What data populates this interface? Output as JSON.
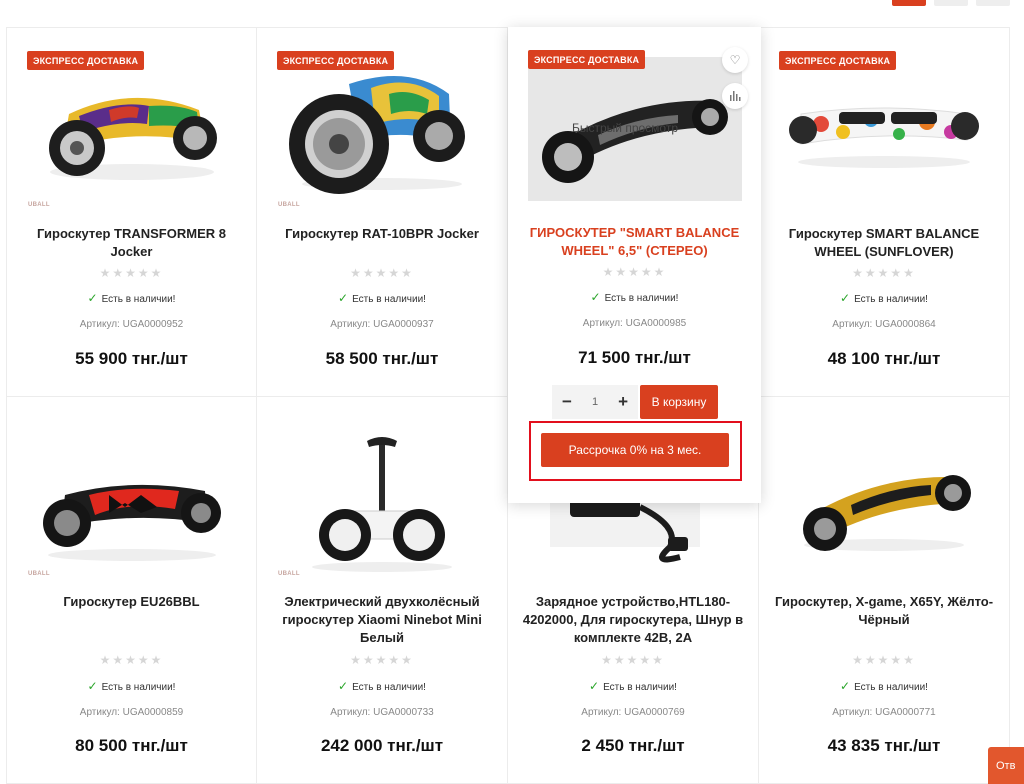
{
  "pagination": {
    "pages": 3,
    "active": 1
  },
  "badge_label": "ЭКСПРЕСС ДОСТАВКА",
  "brand_mark": "UBALL",
  "rating_stars": "★★★★★",
  "stock_check": "✓",
  "products": [
    {
      "title": "Гироскутер TRANSFORMER 8 Jocker",
      "stock": "Есть в наличии!",
      "sku": "Артикул: UGA0000952",
      "price": "55 900 тнг./шт",
      "express": true
    },
    {
      "title": "Гироскутер RAT-10BPR Jocker",
      "stock": "Есть в наличии!",
      "sku": "Артикул: UGA0000937",
      "price": "58 500 тнг./шт",
      "express": true
    },
    {
      "title": "ГИРОСКУТЕР \"SMART BALANCE WHEEL\" 6,5\" (СТЕРЕО)",
      "stock": "Есть в наличии!",
      "sku": "Артикул: UGA0000985",
      "price": "71 500 тнг./шт",
      "express": true,
      "hovered": true
    },
    {
      "title": "Гироскутер SMART BALANCE WHEEL (SUNFLOVER)",
      "stock": "Есть в наличии!",
      "sku": "Артикул: UGA0000864",
      "price": "48 100 тнг./шт",
      "express": true
    },
    {
      "title": "Гироскутер EU26BBL",
      "stock": "Есть в наличии!",
      "sku": "Артикул: UGA0000859",
      "price": "80 500 тнг./шт"
    },
    {
      "title": "Электрический двухколёсный гироскутер Xiaomi Ninebot Mini Белый",
      "stock": "Есть в наличии!",
      "sku": "Артикул: UGA0000733",
      "price": "242 000 тнг./шт"
    },
    {
      "title": "Зарядное устройство,HTL180-4202000, Для гироскутера, Шнур в комплекте 42В, 2А",
      "stock": "Есть в наличии!",
      "sku": "Артикул: UGA0000769",
      "price": "2 450 тнг./шт"
    },
    {
      "title": "Гироскутер, X-game, X65Y, Жёлто-Чёрный",
      "stock": "Есть в наличии!",
      "sku": "Артикул: UGA0000771",
      "price": "43 835 тнг./шт"
    }
  ],
  "hover_panel": {
    "quick_view": "Быстрый просмотр",
    "qty_minus": "−",
    "qty_value": "1",
    "qty_plus": "+",
    "add_to_cart": "В корзину",
    "installment": "Рассрочка 0% на 3 мес."
  },
  "answer_button": "Отв",
  "colors": {
    "accent": "#d9401f",
    "highlight_frame": "#e20f1d",
    "in_stock": "#2aa52a"
  }
}
